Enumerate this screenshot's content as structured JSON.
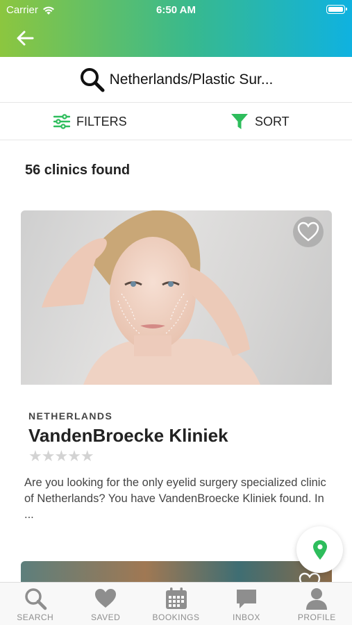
{
  "status_bar": {
    "carrier": "Carrier",
    "time": "6:50 AM"
  },
  "search": {
    "query": "Netherlands/Plastic Sur..."
  },
  "toolbar": {
    "filters_label": "FILTERS",
    "sort_label": "SORT"
  },
  "results": {
    "count_text": "56 clinics found"
  },
  "clinic": {
    "country": "NETHERLANDS",
    "name": "VandenBroecke Kliniek",
    "rating_stars": "★★★★★",
    "description": "Are you looking for the only eyelid surgery specialized clinic of Netherlands? You have VandenBroecke Kliniek found. In ..."
  },
  "tabs": [
    {
      "label": "SEARCH",
      "icon": "search-icon"
    },
    {
      "label": "SAVED",
      "icon": "heart-icon"
    },
    {
      "label": "BOOKINGS",
      "icon": "calendar-icon"
    },
    {
      "label": "INBOX",
      "icon": "chat-icon"
    },
    {
      "label": "PROFILE",
      "icon": "person-icon"
    }
  ],
  "colors": {
    "accent_green": "#2ebd5c",
    "gradient_start": "#8cc63f",
    "gradient_end": "#0fb2e0"
  }
}
